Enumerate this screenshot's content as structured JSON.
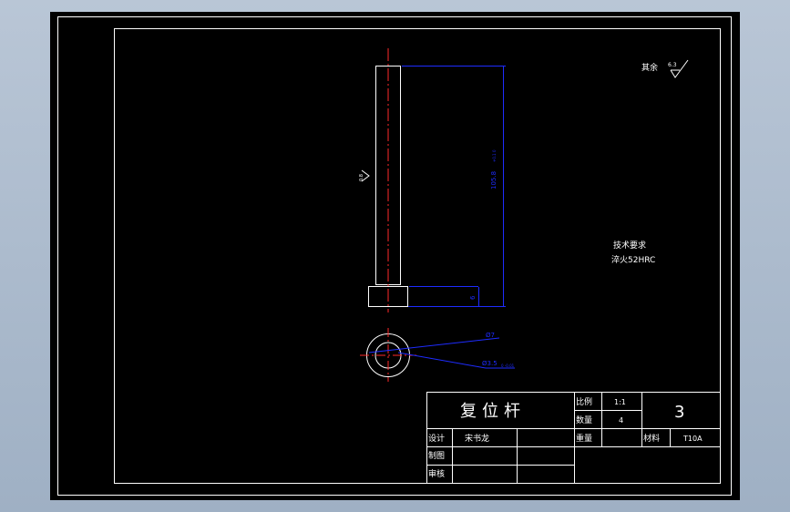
{
  "colors": {
    "viewport_bg": "#000000",
    "frame": "#ffffff",
    "dimension": "#1e2cff",
    "centerline": "#ff2a2a",
    "text": "#ffffff"
  },
  "drawing": {
    "rough_note": "其余",
    "rough_value": "6.3",
    "side_rough_value": "0.8",
    "length_dim": "105.8",
    "length_tol": "+0.1 0",
    "head_dim": "6",
    "dia_outer": "Ø7",
    "dia_inner": "Ø3.5",
    "dia_inner_tol": "0 -0.01",
    "tech_title": "技术要求",
    "tech_item": "淬火52HRC"
  },
  "title_block": {
    "part_name": "复位杆",
    "scale_label": "比例",
    "scale_value": "1:1",
    "qty_label": "数量",
    "qty_value": "4",
    "weight_label": "重量",
    "weight_value": "",
    "material_label": "材料",
    "material_value": "T10A",
    "sheet_number": "3",
    "design_label": "设计",
    "designer": "宋书龙",
    "draw_label": "制图",
    "check_label": "审核"
  }
}
